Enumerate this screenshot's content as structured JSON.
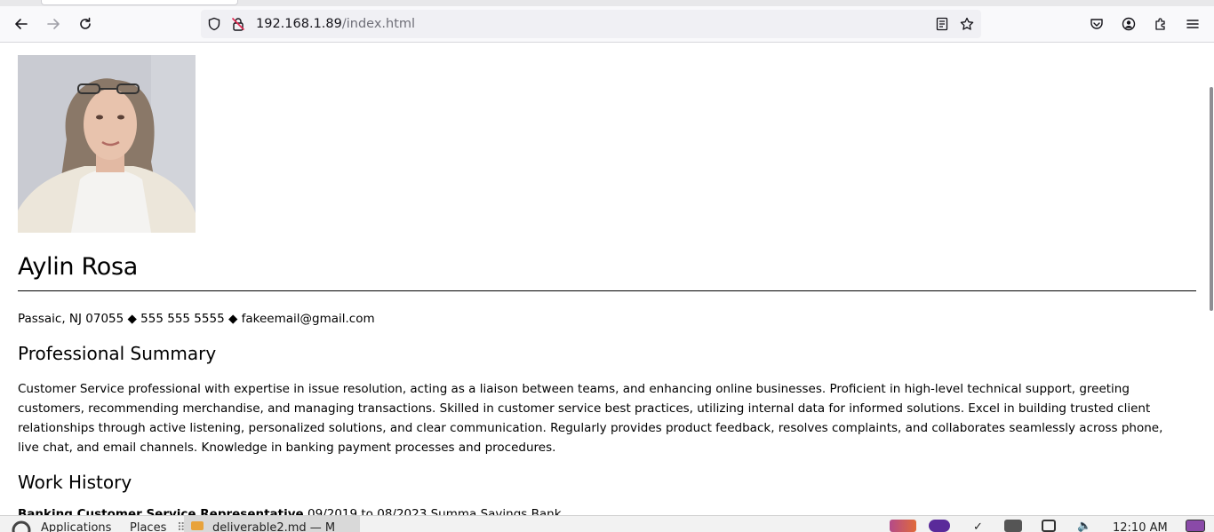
{
  "browser": {
    "url_host": "192.168.1.89",
    "url_path": "/index.html"
  },
  "resume": {
    "name": "Aylin Rosa",
    "contact": "Passaic, NJ 07055 ◆ 555 555 5555 ◆ fakeemail@gmail.com",
    "summary_heading": "Professional Summary",
    "summary": "Customer Service professional with expertise in issue resolution, acting as a liaison between teams, and enhancing online businesses. Proficient in high-level technical support, greeting customers, recommending merchandise, and managing transactions. Skilled in customer service best practices, utilizing internal data for informed solutions. Excel in building trusted client relationships through active listening, personalized solutions, and clear communication. Regularly provides product feedback, resolves complaints, and collaborates seamlessly across phone, live chat, and email channels. Knowledge in banking payment processes and procedures.",
    "work_heading": "Work History",
    "job_title_partial": "Banking Customer Service Representative",
    "job_meta_partial": " 09/2019 to 08/2023 Summa Savings Bank"
  },
  "taskbar": {
    "applications_label": "Applications",
    "places_label": "Places",
    "window_label": "deliverable2.md — M",
    "clock": "12:10 AM"
  },
  "colors": {
    "toolbar_bg": "#f9f9fb",
    "urlbar_bg": "#f0f0f4",
    "insecure_icon": "#e22850"
  }
}
